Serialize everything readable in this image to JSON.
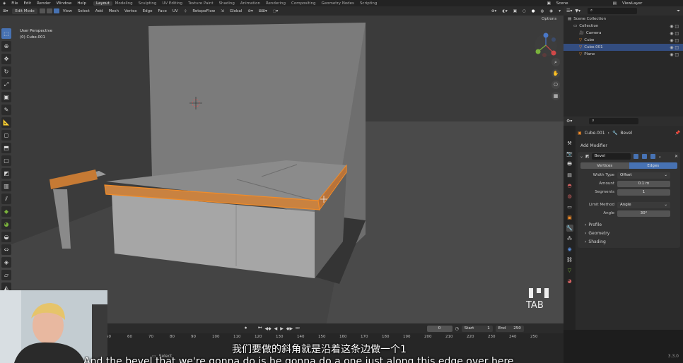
{
  "top_menu": {
    "items": [
      "File",
      "Edit",
      "Render",
      "Window",
      "Help"
    ],
    "workspaces": [
      "Layout",
      "Modeling",
      "Sculpting",
      "UV Editing",
      "Texture Paint",
      "Shading",
      "Animation",
      "Rendering",
      "Compositing",
      "Geometry Nodes",
      "Scripting"
    ],
    "active_workspace": "Layout",
    "scene": "Scene",
    "view_layer": "ViewLayer"
  },
  "viewport_header": {
    "mode": "Edit Mode",
    "menus": [
      "View",
      "Select",
      "Add",
      "Mesh",
      "Vertex",
      "Edge",
      "Face",
      "UV"
    ],
    "transform_orientation": "RetopoFlow",
    "pivot": "Global",
    "options_label": "Options"
  },
  "viewport": {
    "perspective": "User Perspective",
    "object": "(0) Cube.001",
    "key_overlay": "TAB",
    "accent_color": "#f28c28"
  },
  "outliner": {
    "rows": [
      {
        "label": "Scene Collection",
        "depth": 0,
        "selected": false
      },
      {
        "label": "Collection",
        "depth": 1,
        "selected": false
      },
      {
        "label": "Camera",
        "depth": 2,
        "selected": false
      },
      {
        "label": "Cube",
        "depth": 2,
        "selected": false
      },
      {
        "label": "Cube.001",
        "depth": 2,
        "selected": true
      },
      {
        "label": "Plane",
        "depth": 2,
        "selected": false
      }
    ]
  },
  "properties": {
    "breadcrumb_object": "Cube.001",
    "breadcrumb_modifier": "Bevel",
    "add_modifier": "Add Modifier",
    "modifier_name": "Bevel",
    "affect_options": [
      "Vertices",
      "Edges"
    ],
    "affect_selected": "Edges",
    "width_type_label": "Width Type",
    "width_type_value": "Offset",
    "amount_label": "Amount",
    "amount_value": "0.1 m",
    "segments_label": "Segments",
    "segments_value": "1",
    "limit_method_label": "Limit Method",
    "limit_method_value": "Angle",
    "angle_label": "Angle",
    "angle_value": "30°",
    "subpanels": [
      "Profile",
      "Geometry",
      "Shading"
    ]
  },
  "timeline": {
    "current_frame": "0",
    "start_label": "Start",
    "start_value": "1",
    "end_label": "End",
    "end_value": "250",
    "ticks": [
      "50",
      "60",
      "70",
      "80",
      "90",
      "100",
      "110",
      "120",
      "130",
      "140",
      "150",
      "160",
      "170",
      "180",
      "190",
      "200",
      "210",
      "220",
      "230",
      "240",
      "250"
    ]
  },
  "status": {
    "select_label": "Select",
    "version": "3.3.0"
  },
  "subtitles": {
    "chinese": "我们要做的斜角就是沿着这条边做一个1",
    "english": "And the bevel that we're gonna do is he gonna do a one just along this edge over here"
  }
}
